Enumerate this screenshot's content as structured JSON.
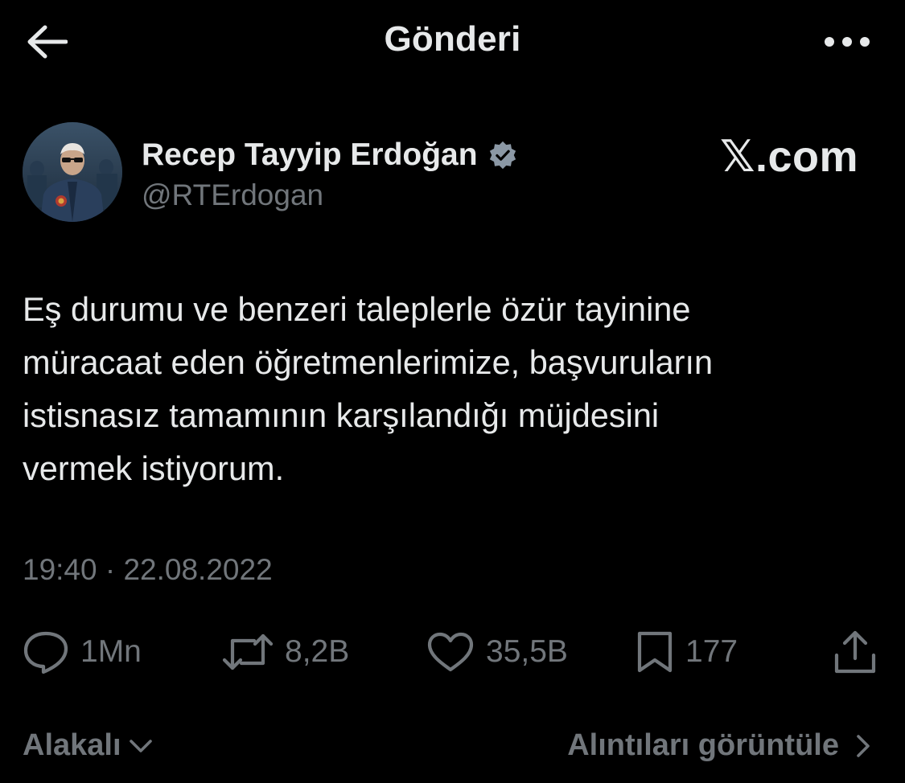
{
  "header": {
    "title": "Gönderi",
    "back_icon": "arrow-left-icon",
    "more_icon": "more-horizontal-icon"
  },
  "author": {
    "name": "Recep Tayyip Erdoğan",
    "handle": "@RTErdogan",
    "verified_icon": "verified-badge-icon",
    "verified_color": "#8b98a5"
  },
  "watermark": {
    "text": "𝕏.com"
  },
  "tweet": {
    "lines": [
      "Eş durumu ve benzeri taleplerle özür tayinine",
      "müracaat eden öğretmenlerimize, başvuruların",
      "istisnasız tamamının karşılandığı müjdesini",
      "vermek istiyorum."
    ],
    "timestamp": "19:40 · 22.08.2022"
  },
  "actions": {
    "reply": {
      "icon": "reply-icon",
      "count": "1Mn"
    },
    "retweet": {
      "icon": "retweet-icon",
      "count": "8,2B"
    },
    "like": {
      "icon": "heart-icon",
      "count": "35,5B"
    },
    "bookmark": {
      "icon": "bookmark-icon",
      "count": "177"
    },
    "share": {
      "icon": "share-icon"
    }
  },
  "footer": {
    "related_label": "Alakalı",
    "related_icon": "chevron-down-icon",
    "quotes_label": "Alıntıları görüntüle",
    "quotes_icon": "chevron-right-icon"
  },
  "colors": {
    "background": "#000000",
    "text_primary": "#e7e9ea",
    "text_secondary": "#71767b"
  }
}
